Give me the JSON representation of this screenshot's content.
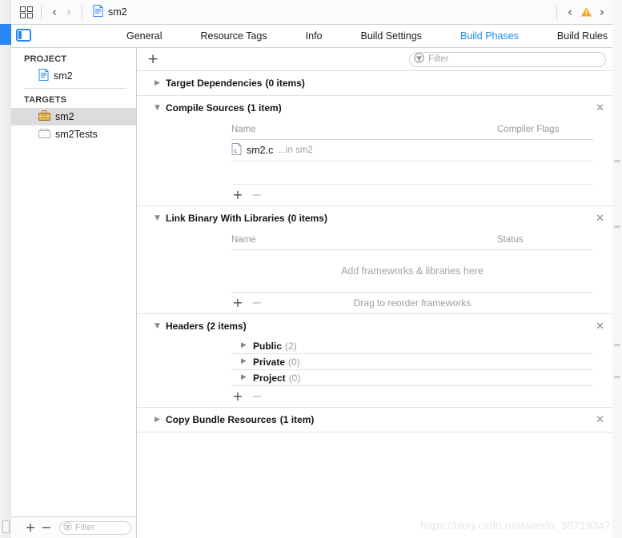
{
  "toolbar": {
    "grid_icon": "grid-icon",
    "back_icon": "chevron-left-icon",
    "forward_icon": "chevron-right-icon",
    "document_icon": "project-document-icon",
    "document_label": "sm2",
    "nav_prev_icon": "chevron-left-icon",
    "warning_icon": "warning-triangle-icon",
    "nav_next_icon": "chevron-right-icon"
  },
  "tabbar": {
    "panel_toggle_icon": "navigator-panel-toggle-icon",
    "tabs": [
      {
        "label": "General",
        "active": false
      },
      {
        "label": "Resource Tags",
        "active": false
      },
      {
        "label": "Info",
        "active": false
      },
      {
        "label": "Build Settings",
        "active": false
      },
      {
        "label": "Build Phases",
        "active": true
      },
      {
        "label": "Build Rules",
        "active": false
      }
    ]
  },
  "sidebar": {
    "project_header": "PROJECT",
    "project_items": [
      {
        "label": "sm2",
        "icon": "blue-project-file-icon",
        "selected": false
      }
    ],
    "targets_header": "TARGETS",
    "target_items": [
      {
        "label": "sm2",
        "icon": "toolbox-target-icon",
        "selected": true
      },
      {
        "label": "sm2Tests",
        "icon": "test-bundle-icon",
        "selected": false
      }
    ],
    "footer": {
      "add_label": "+",
      "remove_label": "−",
      "filter_placeholder": "Filter",
      "filter_value": "",
      "filter_icon": "filter-circle-icon"
    }
  },
  "content": {
    "add_phase_label": "+",
    "filter_placeholder": "Filter",
    "filter_value": "",
    "filter_icon": "filter-circle-icon",
    "phases": [
      {
        "title": "Target Dependencies",
        "count": "(0 items)",
        "expanded": false,
        "triangle": "▶",
        "closable": false
      },
      {
        "title": "Compile Sources",
        "count": "(1 item)",
        "expanded": true,
        "triangle": "▼",
        "closable": true,
        "close_label": "✕",
        "columns": {
          "name": "Name",
          "right": "Compiler Flags"
        },
        "files": [
          {
            "name": "sm2.c",
            "sub": "...in sm2",
            "icon": "c-source-file-icon"
          }
        ],
        "tools": {
          "add": "+",
          "remove": "−",
          "hint": ""
        }
      },
      {
        "title": "Link Binary With Libraries",
        "count": "(0 items)",
        "expanded": true,
        "triangle": "▼",
        "closable": true,
        "close_label": "✕",
        "columns": {
          "name": "Name",
          "right": "Status"
        },
        "empty_hint": "Add frameworks & libraries here",
        "tools": {
          "add": "+",
          "remove": "−",
          "hint": "Drag to reorder frameworks"
        }
      },
      {
        "title": "Headers",
        "count": "(2 items)",
        "expanded": true,
        "triangle": "▼",
        "closable": true,
        "close_label": "✕",
        "groups": [
          {
            "name": "Public",
            "count": "(2)",
            "triangle": "▶"
          },
          {
            "name": "Private",
            "count": "(0)",
            "triangle": "▶"
          },
          {
            "name": "Project",
            "count": "(0)",
            "triangle": "▶"
          }
        ],
        "tools": {
          "add": "+",
          "remove": "−",
          "hint": ""
        }
      },
      {
        "title": "Copy Bundle Resources",
        "count": "(1 item)",
        "expanded": false,
        "triangle": "▶",
        "closable": true,
        "close_label": "✕"
      }
    ]
  },
  "watermark": "https://blog.csdn.net/weixin_38719347",
  "colors": {
    "accent": "#1e8fe8",
    "selection": "#dcdcdc",
    "warning": "#f5a623",
    "edge_blue": "#2b86f5"
  }
}
